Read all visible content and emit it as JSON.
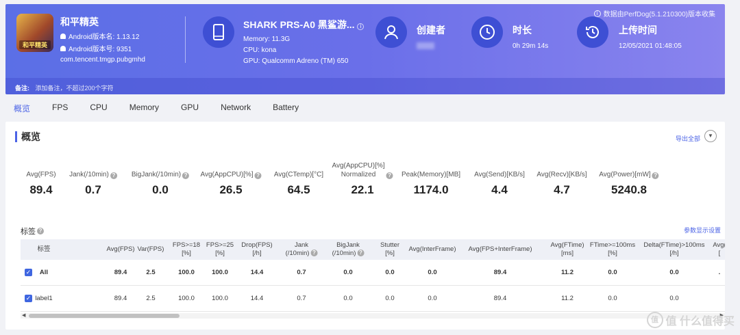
{
  "header": {
    "note": "数据由PerfDog(5.1.210300)版本收集",
    "app": {
      "icon_text": "和平精英",
      "name": "和平精英",
      "version_name": "Android版本名: 1.13.12",
      "version_code": "Android版本号: 9351",
      "package": "com.tencent.tmgp.pubgmhd"
    },
    "device": {
      "title": "SHARK PRS-A0 黑鲨游...",
      "memory": "Memory: 11.3G",
      "cpu": "CPU: kona",
      "gpu": "GPU: Qualcomm Adreno (TM) 650",
      "icon": "phone-icon"
    },
    "creator": {
      "title": "创建者",
      "icon": "user-icon"
    },
    "duration": {
      "title": "时长",
      "value": "0h 29m 14s",
      "icon": "clock-icon"
    },
    "upload": {
      "title": "上传时间",
      "value": "12/05/2021 01:48:05",
      "icon": "history-icon"
    },
    "note_bar": {
      "label": "备注:",
      "placeholder": "添加备注，不超过200个字符"
    }
  },
  "tabs": [
    "概览",
    "FPS",
    "CPU",
    "Memory",
    "GPU",
    "Network",
    "Battery"
  ],
  "active_tab": "概览",
  "overview": {
    "title": "概览",
    "export": "导出全部",
    "metrics": [
      {
        "label": "Avg(FPS)",
        "value": "89.4",
        "help": false
      },
      {
        "label": "Jank(/10min)",
        "value": "0.7",
        "help": true
      },
      {
        "label": "BigJank(/10min)",
        "value": "0.0",
        "help": true
      },
      {
        "label": "Avg(AppCPU)[%]",
        "value": "26.5",
        "help": true
      },
      {
        "label": "Avg(CTemp)[°C]",
        "value": "64.5",
        "help": false
      },
      {
        "label": "Avg(AppCPU)[%]\nNormalized",
        "value": "22.1",
        "help": true
      },
      {
        "label": "Peak(Memory)[MB]",
        "value": "1174.0",
        "help": false
      },
      {
        "label": "Avg(Send)[KB/s]",
        "value": "4.4",
        "help": false
      },
      {
        "label": "Avg(Recv)[KB/s]",
        "value": "4.7",
        "help": false
      },
      {
        "label": "Avg(Power)[mW]",
        "value": "5240.8",
        "help": true
      }
    ],
    "tags_title": "标签",
    "param_settings": "参数显示设置",
    "table": {
      "columns": [
        "标签",
        "Avg(FPS)",
        "Var(FPS)",
        "FPS>=18\n[%]",
        "FPS>=25\n[%]",
        "Drop(FPS)\n[/h]",
        "Jank\n(/10min)",
        "BigJank\n(/10min)",
        "Stutter\n[%]",
        "Avg(InterFrame)",
        "Avg(FPS+InterFrame)",
        "Avg(FTime)\n[ms]",
        "FTime>=100ms\n[%]",
        "Delta(FTime)>100ms\n[/h]",
        "Avg(\n["
      ],
      "rows": [
        {
          "label": "All",
          "bold": true,
          "values": [
            "89.4",
            "2.5",
            "100.0",
            "100.0",
            "14.4",
            "0.7",
            "0.0",
            "0.0",
            "0.0",
            "89.4",
            "11.2",
            "0.0",
            "0.0",
            "."
          ]
        },
        {
          "label": "label1",
          "bold": false,
          "values": [
            "89.4",
            "2.5",
            "100.0",
            "100.0",
            "14.4",
            "0.7",
            "0.0",
            "0.0",
            "0.0",
            "89.4",
            "11.2",
            "0.0",
            "0.0",
            ""
          ]
        }
      ]
    }
  },
  "watermark": "值 什么值得买",
  "colors": {
    "accent": "#4b63e6",
    "header_start": "#5b6fe6",
    "header_end": "#8a84ee",
    "icon_circle": "#3e4fd4"
  }
}
